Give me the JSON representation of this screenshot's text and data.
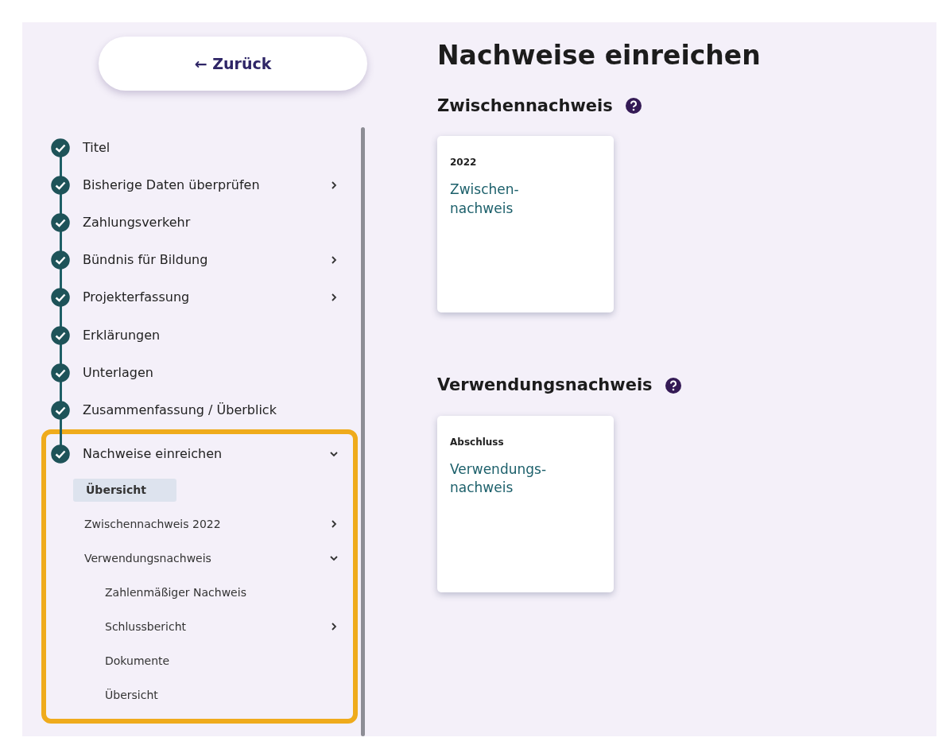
{
  "back_button": {
    "label": "← Zurück"
  },
  "steps": [
    {
      "label": "Titel",
      "done": true
    },
    {
      "label": "Bisherige Daten überprüfen",
      "done": true,
      "expanded": false
    },
    {
      "label": "Zahlungsverkehr",
      "done": true
    },
    {
      "label": "Bündnis für Bildung",
      "done": true,
      "expanded": false
    },
    {
      "label": "Projekterfassung",
      "done": true,
      "expanded": false
    },
    {
      "label": "Erklärungen",
      "done": true
    },
    {
      "label": "Unterlagen",
      "done": true
    },
    {
      "label": "Zusammenfassung / Überblick",
      "done": true
    },
    {
      "label": "Nachweise einreichen",
      "done": true,
      "expanded": true,
      "highlighted": true,
      "children": [
        {
          "label": "Übersicht",
          "selected": true
        },
        {
          "label": "Zwischennachweis 2022",
          "selected": false,
          "expanded": false
        },
        {
          "label": "Verwendungsnachweis",
          "selected": false,
          "expanded": true,
          "children": [
            {
              "label": "Zahlenmäßiger Nachweis",
              "selected": false
            },
            {
              "label": "Schlussbericht",
              "selected": false,
              "expanded": false
            },
            {
              "label": "Dokumente",
              "selected": false
            },
            {
              "label": "Übersicht",
              "selected": false
            }
          ]
        }
      ]
    }
  ],
  "main": {
    "title": "Nachweise einreichen",
    "sections": [
      {
        "heading": "Zwischennachweis",
        "cards": [
          {
            "caption": "2022",
            "link": "Zwischen-\nnachweis"
          }
        ]
      },
      {
        "heading": "Verwendungsnachweis",
        "cards": [
          {
            "caption": "Abschluss",
            "link": "Verwendungs-\nnachweis"
          }
        ]
      }
    ]
  }
}
